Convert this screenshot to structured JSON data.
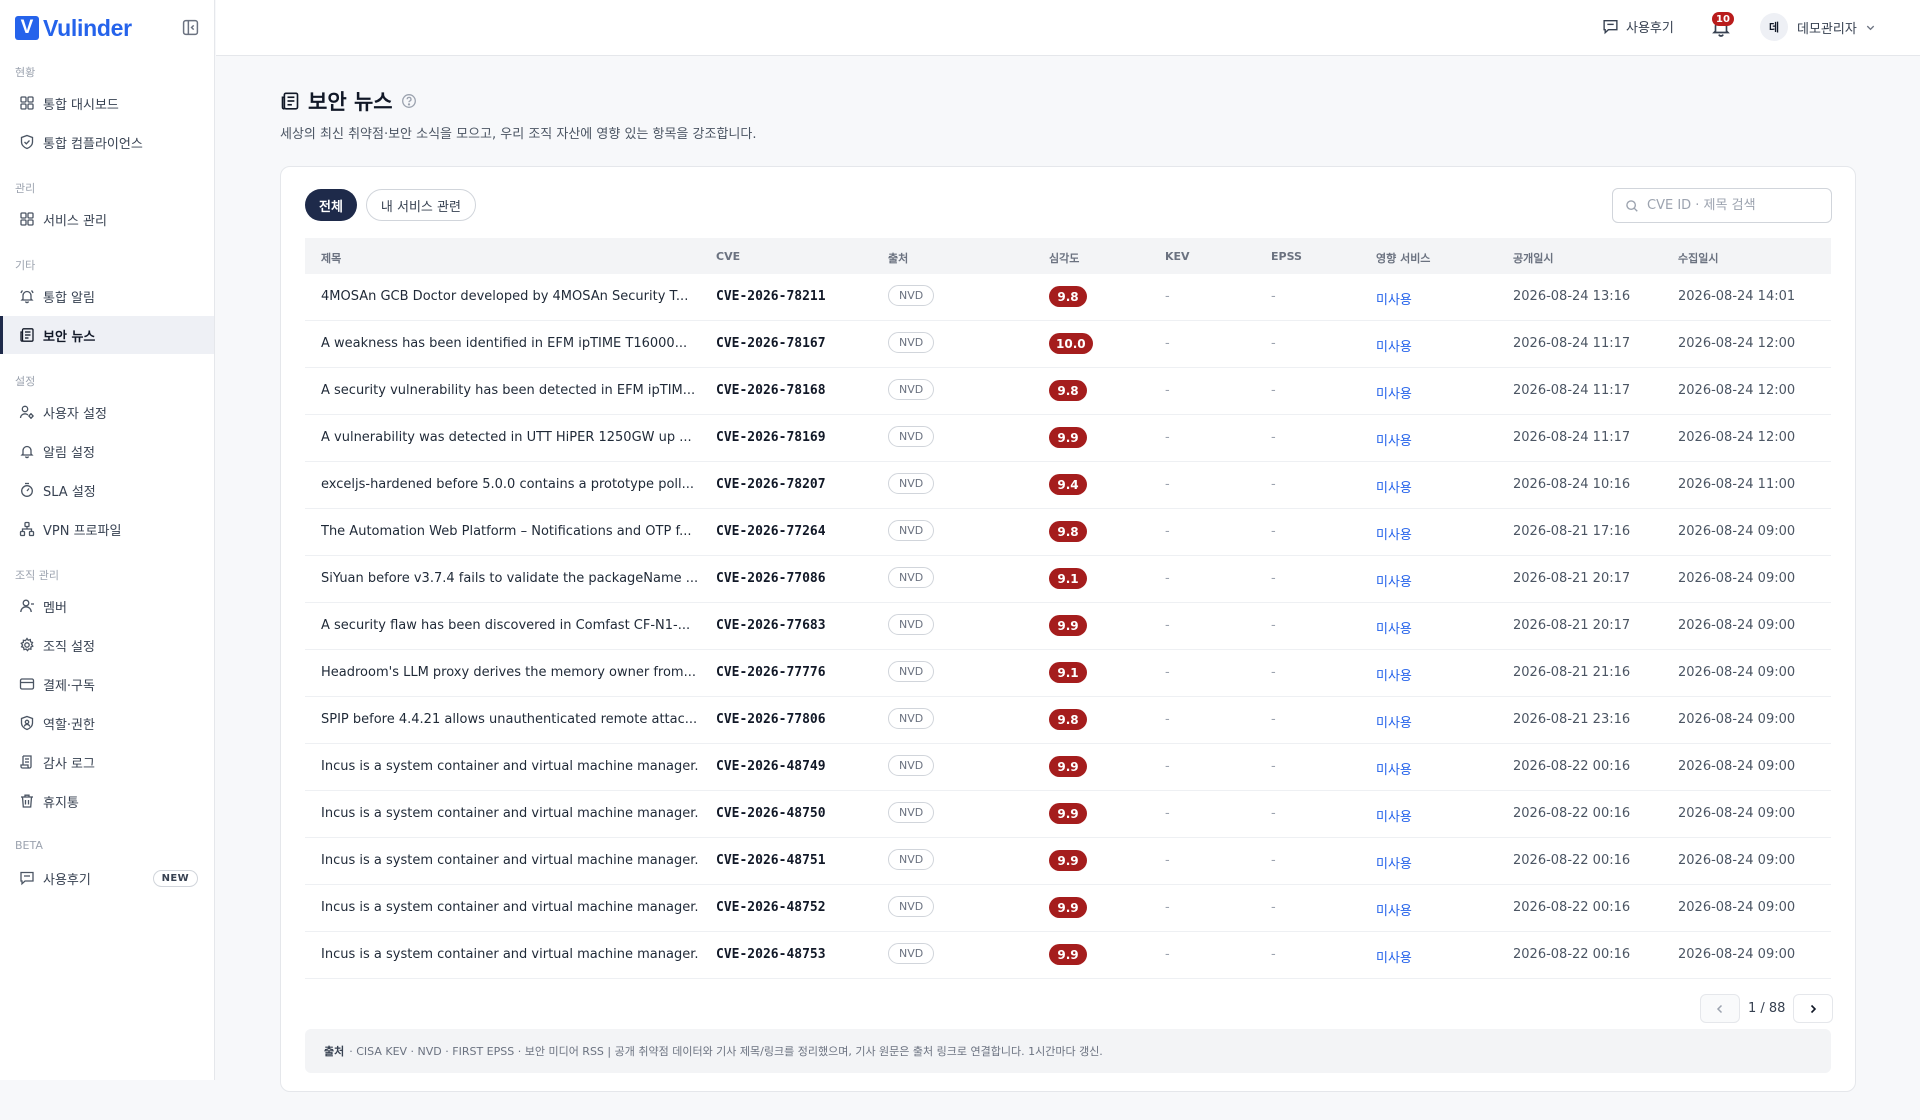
{
  "brand": {
    "mark": "V",
    "name": "Vulinder"
  },
  "nav": {
    "sections": [
      {
        "label": "현황",
        "items": [
          {
            "label": "통합 대시보드"
          },
          {
            "label": "통합 컴플라이언스"
          }
        ]
      },
      {
        "label": "관리",
        "items": [
          {
            "label": "서비스 관리"
          }
        ]
      },
      {
        "label": "기타",
        "items": [
          {
            "label": "통합 알림"
          },
          {
            "label": "보안 뉴스"
          }
        ]
      },
      {
        "label": "설정",
        "items": [
          {
            "label": "사용자 설정"
          },
          {
            "label": "알림 설정"
          },
          {
            "label": "SLA 설정"
          },
          {
            "label": "VPN 프로파일"
          }
        ]
      },
      {
        "label": "조직 관리",
        "items": [
          {
            "label": "멤버"
          },
          {
            "label": "조직 설정"
          },
          {
            "label": "결제·구독"
          },
          {
            "label": "역할·권한"
          },
          {
            "label": "감사 로그"
          },
          {
            "label": "휴지통"
          }
        ]
      },
      {
        "label": "BETA",
        "items": [
          {
            "label": "사용후기",
            "badge": "NEW"
          }
        ]
      }
    ]
  },
  "topbar": {
    "feedback_label": "사용후기",
    "notification_count": "10",
    "user_initial": "데",
    "user_name": "데모관리자"
  },
  "page": {
    "title": "보안 뉴스",
    "subtitle": "세상의 최신 취약점·보안 소식을 모으고, 우리 조직 자산에 영향 있는 항목을 강조합니다."
  },
  "tabs": [
    {
      "label": "전체",
      "active": true
    },
    {
      "label": "내 서비스 관련",
      "active": false
    }
  ],
  "search": {
    "placeholder": "CVE ID · 제목 검색",
    "value": ""
  },
  "table": {
    "headers": {
      "title": "제목",
      "cve": "CVE",
      "source": "출처",
      "severity": "심각도",
      "kev": "KEV",
      "epss": "EPSS",
      "service": "영향 서비스",
      "published": "공개일시",
      "collected": "수집일시"
    },
    "rows": [
      {
        "title": "4MOSAn GCB Doctor developed by 4MOSAn Security T...",
        "cve": "CVE-2026-78211",
        "source": "NVD",
        "severity": "9.8",
        "kev": "-",
        "epss": "-",
        "service": "미사용",
        "published": "2026-08-24 13:16",
        "collected": "2026-08-24 14:01"
      },
      {
        "title": "A weakness has been identified in EFM ipTIME T16000...",
        "cve": "CVE-2026-78167",
        "source": "NVD",
        "severity": "10.0",
        "kev": "-",
        "epss": "-",
        "service": "미사용",
        "published": "2026-08-24 11:17",
        "collected": "2026-08-24 12:00"
      },
      {
        "title": "A security vulnerability has been detected in EFM ipTIM...",
        "cve": "CVE-2026-78168",
        "source": "NVD",
        "severity": "9.8",
        "kev": "-",
        "epss": "-",
        "service": "미사용",
        "published": "2026-08-24 11:17",
        "collected": "2026-08-24 12:00"
      },
      {
        "title": "A vulnerability was detected in UTT HiPER 1250GW up ...",
        "cve": "CVE-2026-78169",
        "source": "NVD",
        "severity": "9.9",
        "kev": "-",
        "epss": "-",
        "service": "미사용",
        "published": "2026-08-24 11:17",
        "collected": "2026-08-24 12:00"
      },
      {
        "title": "exceljs-hardened before 5.0.0 contains a prototype poll...",
        "cve": "CVE-2026-78207",
        "source": "NVD",
        "severity": "9.4",
        "kev": "-",
        "epss": "-",
        "service": "미사용",
        "published": "2026-08-24 10:16",
        "collected": "2026-08-24 11:00"
      },
      {
        "title": "The Automation Web Platform – Notifications and OTP f...",
        "cve": "CVE-2026-77264",
        "source": "NVD",
        "severity": "9.8",
        "kev": "-",
        "epss": "-",
        "service": "미사용",
        "published": "2026-08-21 17:16",
        "collected": "2026-08-24 09:00"
      },
      {
        "title": "SiYuan before v3.7.4 fails to validate the packageName ...",
        "cve": "CVE-2026-77086",
        "source": "NVD",
        "severity": "9.1",
        "kev": "-",
        "epss": "-",
        "service": "미사용",
        "published": "2026-08-21 20:17",
        "collected": "2026-08-24 09:00"
      },
      {
        "title": "A security flaw has been discovered in Comfast CF-N1-...",
        "cve": "CVE-2026-77683",
        "source": "NVD",
        "severity": "9.9",
        "kev": "-",
        "epss": "-",
        "service": "미사용",
        "published": "2026-08-21 20:17",
        "collected": "2026-08-24 09:00"
      },
      {
        "title": "Headroom's LLM proxy derives the memory owner from...",
        "cve": "CVE-2026-77776",
        "source": "NVD",
        "severity": "9.1",
        "kev": "-",
        "epss": "-",
        "service": "미사용",
        "published": "2026-08-21 21:16",
        "collected": "2026-08-24 09:00"
      },
      {
        "title": "SPIP before 4.4.21 allows unauthenticated remote attac...",
        "cve": "CVE-2026-77806",
        "source": "NVD",
        "severity": "9.8",
        "kev": "-",
        "epss": "-",
        "service": "미사용",
        "published": "2026-08-21 23:16",
        "collected": "2026-08-24 09:00"
      },
      {
        "title": "Incus is a system container and virtual machine manager.",
        "cve": "CVE-2026-48749",
        "source": "NVD",
        "severity": "9.9",
        "kev": "-",
        "epss": "-",
        "service": "미사용",
        "published": "2026-08-22 00:16",
        "collected": "2026-08-24 09:00"
      },
      {
        "title": "Incus is a system container and virtual machine manager.",
        "cve": "CVE-2026-48750",
        "source": "NVD",
        "severity": "9.9",
        "kev": "-",
        "epss": "-",
        "service": "미사용",
        "published": "2026-08-22 00:16",
        "collected": "2026-08-24 09:00"
      },
      {
        "title": "Incus is a system container and virtual machine manager.",
        "cve": "CVE-2026-48751",
        "source": "NVD",
        "severity": "9.9",
        "kev": "-",
        "epss": "-",
        "service": "미사용",
        "published": "2026-08-22 00:16",
        "collected": "2026-08-24 09:00"
      },
      {
        "title": "Incus is a system container and virtual machine manager.",
        "cve": "CVE-2026-48752",
        "source": "NVD",
        "severity": "9.9",
        "kev": "-",
        "epss": "-",
        "service": "미사용",
        "published": "2026-08-22 00:16",
        "collected": "2026-08-24 09:00"
      },
      {
        "title": "Incus is a system container and virtual machine manager.",
        "cve": "CVE-2026-48753",
        "source": "NVD",
        "severity": "9.9",
        "kev": "-",
        "epss": "-",
        "service": "미사용",
        "published": "2026-08-22 00:16",
        "collected": "2026-08-24 09:00"
      }
    ]
  },
  "pagination": {
    "label": "1 / 88"
  },
  "footnote": {
    "label": "출처",
    "text": "· CISA KEV · NVD · FIRST EPSS · 보안 미디어 RSS  |  공개 취약점 데이터와 기사 제목/링크를 정리했으며, 기사 원문은 출처 링크로 연결합니다. 1시간마다 갱신."
  },
  "colors": {
    "brand": "#2563eb",
    "active_nav": "#1e2a4a",
    "severity_critical": "#a51d1d",
    "link": "#2563eb"
  },
  "icons": {
    "collapse": "sidebar-collapse-icon",
    "page": "newspaper-icon",
    "help": "help-circle-icon",
    "feedback": "message-square-icon",
    "bell": "bell-icon",
    "search": "search-icon",
    "chevron_down": "chevron-down-icon",
    "chevron_left": "chevron-left-icon",
    "chevron_right": "chevron-right-icon"
  }
}
